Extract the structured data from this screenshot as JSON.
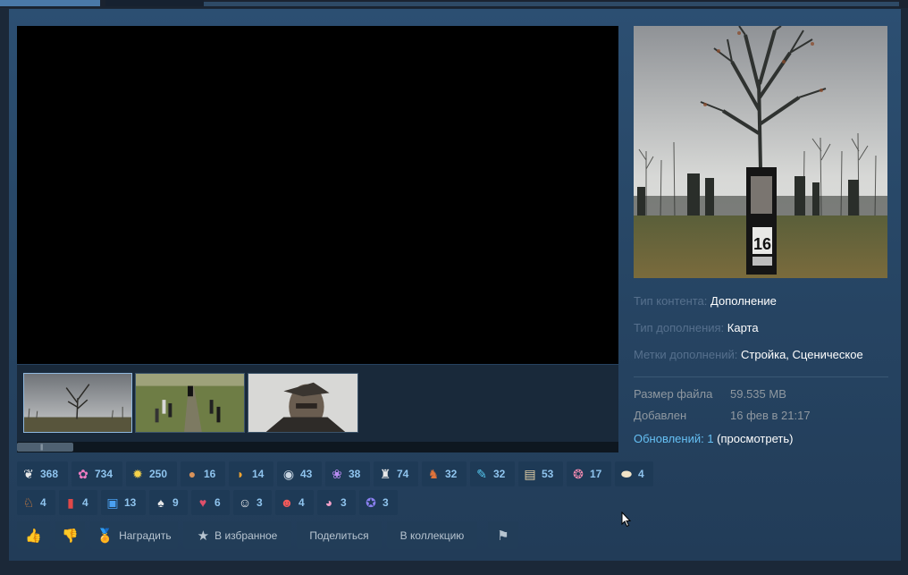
{
  "details": {
    "content_type_label": "Тип контента:",
    "content_type_value": "Дополнение",
    "addon_type_label": "Тип дополнения:",
    "addon_type_value": "Карта",
    "addon_tags_label": "Метки дополнений:",
    "addon_tags_value": "Стройка, Сценическое",
    "file_size_label": "Размер файла",
    "file_size_value": "59.535 MB",
    "added_label": "Добавлен",
    "added_value": "16 фев в 21:17",
    "updates_link": "Обновлений: 1",
    "view_link": "(просмотреть)"
  },
  "preview": {
    "plate_number": "16"
  },
  "awards": [
    {
      "icon": "hearts-icon",
      "glyph": "❦",
      "color": "#e8e8e8",
      "count": "368"
    },
    {
      "icon": "pink-blob-icon",
      "glyph": "✿",
      "color": "#f07cc2",
      "count": "734"
    },
    {
      "icon": "sun-icon",
      "glyph": "✹",
      "color": "#f6d24a",
      "count": "250"
    },
    {
      "icon": "cookie-icon",
      "glyph": "●",
      "color": "#d9925a",
      "count": "16"
    },
    {
      "icon": "banana-icon",
      "glyph": "◗",
      "color": "#f2a531",
      "count": "14"
    },
    {
      "icon": "eye-ball-icon",
      "glyph": "◉",
      "color": "#c9d6e3",
      "count": "43"
    },
    {
      "icon": "purple-wing-icon",
      "glyph": "❀",
      "color": "#b88cf2",
      "count": "38"
    },
    {
      "icon": "bust-icon",
      "glyph": "♜",
      "color": "#e8e8e8",
      "count": "74"
    },
    {
      "icon": "squirrel-icon",
      "glyph": "♞",
      "color": "#e0733a",
      "count": "32"
    },
    {
      "icon": "microphone-icon",
      "glyph": "✎",
      "color": "#55c8f0",
      "count": "32"
    },
    {
      "icon": "scroll-icon",
      "glyph": "▤",
      "color": "#e6d2a8",
      "count": "53"
    },
    {
      "icon": "brain-icon",
      "glyph": "❂",
      "color": "#f28ab0",
      "count": "17"
    },
    {
      "icon": "egg-icon",
      "glyph": "⬬",
      "color": "#f2e4c8",
      "count": "4"
    },
    {
      "icon": "fox-icon",
      "glyph": "♘",
      "color": "#f08a3a",
      "count": "4"
    },
    {
      "icon": "soda-can-icon",
      "glyph": "▮",
      "color": "#e04848",
      "count": "4"
    },
    {
      "icon": "gift-icon",
      "glyph": "▣",
      "color": "#4aa0f0",
      "count": "13"
    },
    {
      "icon": "mushroom-icon",
      "glyph": "♠",
      "color": "#e8e8e8",
      "count": "9"
    },
    {
      "icon": "hearts-pile-icon",
      "glyph": "♥",
      "color": "#e0506a",
      "count": "6"
    },
    {
      "icon": "baby-face-icon",
      "glyph": "☺",
      "color": "#f2f2f2",
      "count": "3"
    },
    {
      "icon": "laughing-face-icon",
      "glyph": "☻",
      "color": "#f25a5a",
      "count": "4"
    },
    {
      "icon": "pig-icon",
      "glyph": "◕",
      "color": "#f2a0c8",
      "count": "3"
    },
    {
      "icon": "cat-face-icon",
      "glyph": "✪",
      "color": "#8a80f0",
      "count": "3"
    }
  ],
  "buttons": {
    "award": "Наградить",
    "favorite": "В избранное",
    "share": "Поделиться",
    "collection": "В коллекцию"
  }
}
